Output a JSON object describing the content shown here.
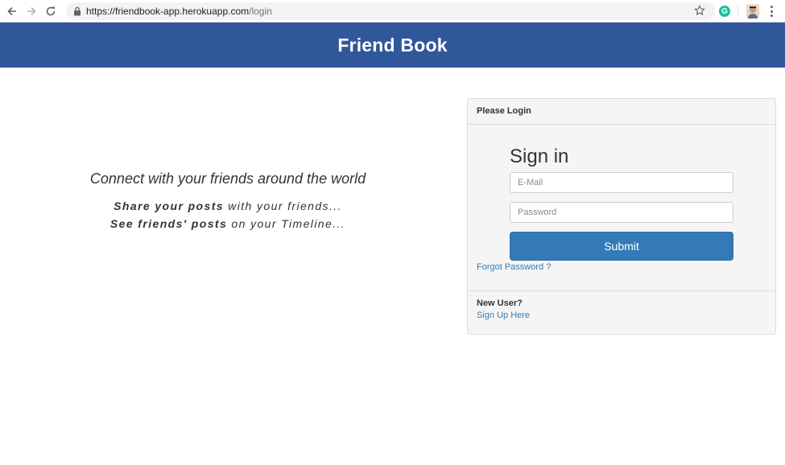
{
  "browser": {
    "url_main": "https://friendbook-app.herokuapp.com",
    "url_path": "/login",
    "grammarly_letter": "G"
  },
  "header": {
    "brand": "Friend Book",
    "color": "#31579b"
  },
  "hero": {
    "tagline": "Connect with your friends around the world",
    "line1_bold": "Share your posts",
    "line1_rest": " with your friends...",
    "line2_bold": "See friends' posts",
    "line2_rest": " on your Timeline..."
  },
  "login": {
    "heading": "Please Login",
    "title": "Sign in",
    "email_placeholder": "E-Mail",
    "password_placeholder": "Password",
    "submit_label": "Submit",
    "forgot_label": "Forgot Password ?",
    "new_user_label": "New User?",
    "signup_label": "Sign Up Here",
    "accent": "#337ab7"
  }
}
